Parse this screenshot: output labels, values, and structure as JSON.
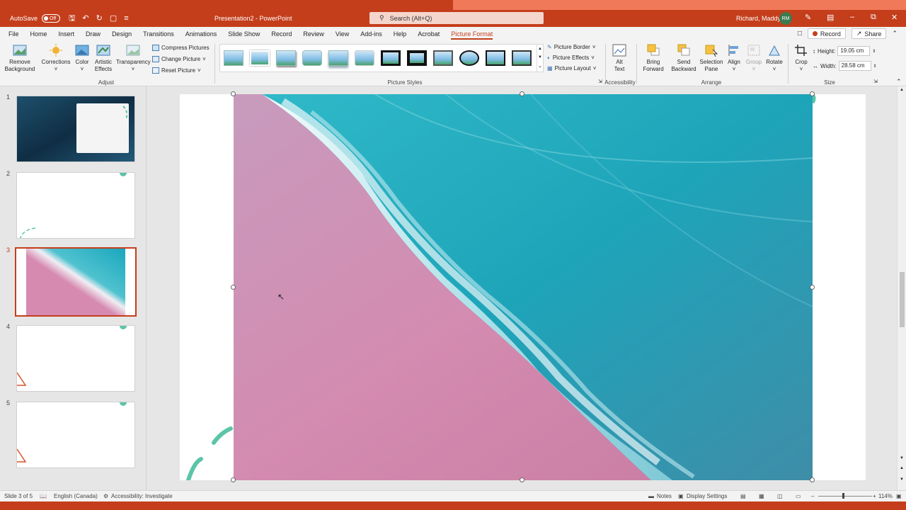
{
  "window": {
    "autosave_label": "AutoSave",
    "autosave_state": "Off",
    "doc_title": "Presentation2  -  PowerPoint",
    "search_placeholder": "Search (Alt+Q)",
    "user_name": "Richard, Maddy",
    "user_initials": "RM",
    "accent": "#c43e1c"
  },
  "tabs": [
    "File",
    "Home",
    "Insert",
    "Draw",
    "Design",
    "Transitions",
    "Animations",
    "Slide Show",
    "Record",
    "Review",
    "View",
    "Add-ins",
    "Help",
    "Acrobat",
    "Picture Format"
  ],
  "active_tab": "Picture Format",
  "tab_actions": {
    "record": "Record",
    "share": "Share"
  },
  "ribbon": {
    "adjust": {
      "remove_background": [
        "Remove",
        "Background"
      ],
      "corrections": "Corrections",
      "color": "Color",
      "artistic_effects": [
        "Artistic",
        "Effects"
      ],
      "transparency": "Transparency",
      "compress": "Compress Pictures",
      "change": "Change Picture",
      "reset": "Reset Picture",
      "label": "Adjust"
    },
    "picture_styles": {
      "label": "Picture Styles",
      "border": "Picture Border",
      "effects": "Picture Effects",
      "layout": "Picture Layout"
    },
    "accessibility": {
      "alt_text": [
        "Alt",
        "Text"
      ],
      "label": "Accessibility"
    },
    "arrange": {
      "bring_forward": [
        "Bring",
        "Forward"
      ],
      "send_backward": [
        "Send",
        "Backward"
      ],
      "selection_pane": [
        "Selection",
        "Pane"
      ],
      "align": "Align",
      "group": "Group",
      "rotate": "Rotate",
      "label": "Arrange"
    },
    "size": {
      "crop": "Crop",
      "height_label": "Height:",
      "height_value": "19.05 cm",
      "width_label": "Width:",
      "width_value": "28.58 cm",
      "label": "Size"
    }
  },
  "slides": [
    {
      "num": "1"
    },
    {
      "num": "2"
    },
    {
      "num": "3"
    },
    {
      "num": "4"
    },
    {
      "num": "5"
    }
  ],
  "active_slide": 3,
  "status": {
    "slide_info": "Slide 3 of 5",
    "language": "English (Canada)",
    "accessibility": "Accessibility: Investigate",
    "notes": "Notes",
    "display_settings": "Display Settings",
    "zoom": "114%"
  }
}
